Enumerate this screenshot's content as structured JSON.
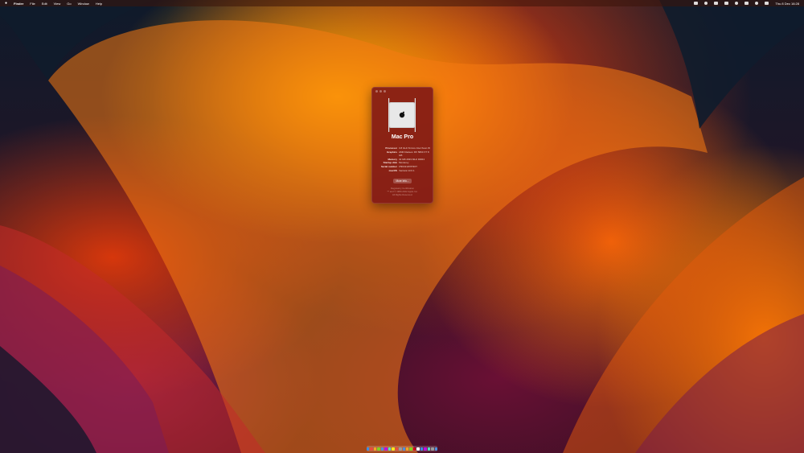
{
  "menubar": {
    "apple": "",
    "app": "Finder",
    "menus": [
      "File",
      "Edit",
      "View",
      "Go",
      "Window",
      "Help"
    ],
    "clock": "Thu 8 Dec 16:28"
  },
  "about": {
    "title": "Mac Pro",
    "specs": [
      {
        "k": "Processor",
        "v": "3.8 GHz 8-Core Intel Xeon W"
      },
      {
        "k": "Graphics",
        "v": "AMD Radeon RX 5800 XT 8 GB"
      },
      {
        "k": "Memory",
        "v": "32 GB 2933 MHz DDR4"
      },
      {
        "k": "Startup disk",
        "v": "Monterey"
      },
      {
        "k": "Serial number",
        "v": "F5KD21W7P3XT"
      },
      {
        "k": "macOS",
        "v": "Ventura 13.0.1"
      }
    ],
    "more_info": "More Info...",
    "footer1": "Regulatory Certification",
    "footer2": "™ and © 1983-2022 Apple Inc.",
    "footer3": "All Rights Reserved."
  },
  "dock_colors": [
    "#3a8ee6",
    "#e94b3c",
    "#f5a623",
    "#7ed321",
    "#4a90e2",
    "#bd10e0",
    "#50e3c2",
    "#f8e71c",
    "#e94b3c",
    "#9b9b9b",
    "#4a90e2",
    "#f5a623",
    "#7ed321",
    "#d0021b",
    "#ffffff",
    "#3a8ee6",
    "#bd10e0",
    "#50e3c2",
    "#9b9b9b",
    "#4a90e2"
  ]
}
